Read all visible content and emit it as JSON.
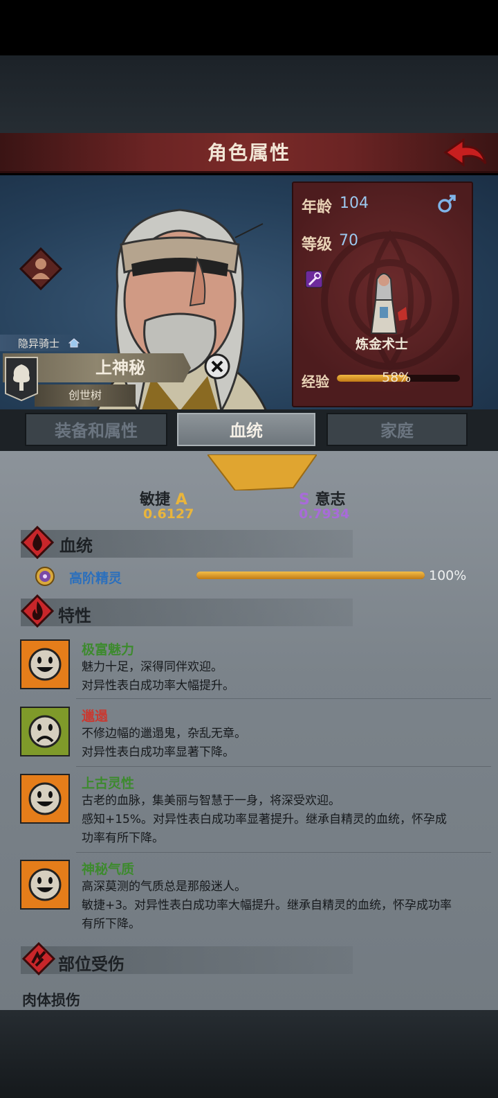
{
  "header": {
    "title": "角色属性"
  },
  "character": {
    "title_badge": "隐异骑士",
    "name": "上神秘",
    "guild": "创世树",
    "age_label": "年龄",
    "age": "104",
    "level_label": "等级",
    "level": "70",
    "class_name": "炼金术士",
    "exp_label": "经验",
    "exp_percent_text": "58%",
    "exp_fraction": 0.58
  },
  "tabs": [
    {
      "label": "装备和属性",
      "active": false
    },
    {
      "label": "血统",
      "active": true
    },
    {
      "label": "家庭",
      "active": false
    }
  ],
  "attributes": {
    "left": {
      "name": "敏捷",
      "grade": "A",
      "value": "0.6127"
    },
    "right": {
      "grade": "S",
      "name": "意志",
      "value": "0.7934"
    }
  },
  "sections": {
    "lineage": "血统",
    "traits": "特性",
    "injuries": "部位受伤"
  },
  "lineage": {
    "name": "高阶精灵",
    "percent_text": "100%",
    "fraction": 1.0
  },
  "traits": [
    {
      "name": "极富魅力",
      "color": "#3d8a2e",
      "mood": "happy",
      "lines": [
        "魅力十足，深得同伴欢迎。",
        "对异性表白成功率大幅提升。"
      ]
    },
    {
      "name": "邋遢",
      "color": "#c83a32",
      "mood": "sad",
      "lines": [
        "不修边幅的邋遢鬼，杂乱无章。",
        "对异性表白成功率显著下降。"
      ]
    },
    {
      "name": "上古灵性",
      "color": "#3d8a2e",
      "mood": "happy",
      "lines": [
        "古老的血脉，集美丽与智慧于一身，将深受欢迎。",
        "感知+15%。对异性表白成功率显著提升。继承自精灵的血统，怀孕成",
        "功率有所下降。"
      ]
    },
    {
      "name": "神秘气质",
      "color": "#3d8a2e",
      "mood": "happy",
      "lines": [
        "高深莫测的气质总是那般迷人。",
        "敏捷+3。对异性表白成功率大幅提升。继承自精灵的血统，怀孕成功率",
        "有所下降。"
      ]
    }
  ],
  "injuries": {
    "body_damage": "肉体损伤"
  },
  "colors": {
    "header_red": "#6b2424",
    "exp_gold": "#e9b53c",
    "attr_purple": "#a86bd9",
    "lineage_blue": "#2a6fbd",
    "trait_good": "#3d8a2e",
    "trait_bad": "#c83a32"
  },
  "icons": [
    "back-arrow-icon",
    "class-emblem-icon",
    "home-icon",
    "guild-crest-icon",
    "close-icon",
    "male-icon",
    "staff-icon",
    "blood-drop-icon",
    "flame-icon",
    "injury-icon",
    "elf-lineage-icon",
    "happy-face-icon",
    "sad-face-icon"
  ]
}
